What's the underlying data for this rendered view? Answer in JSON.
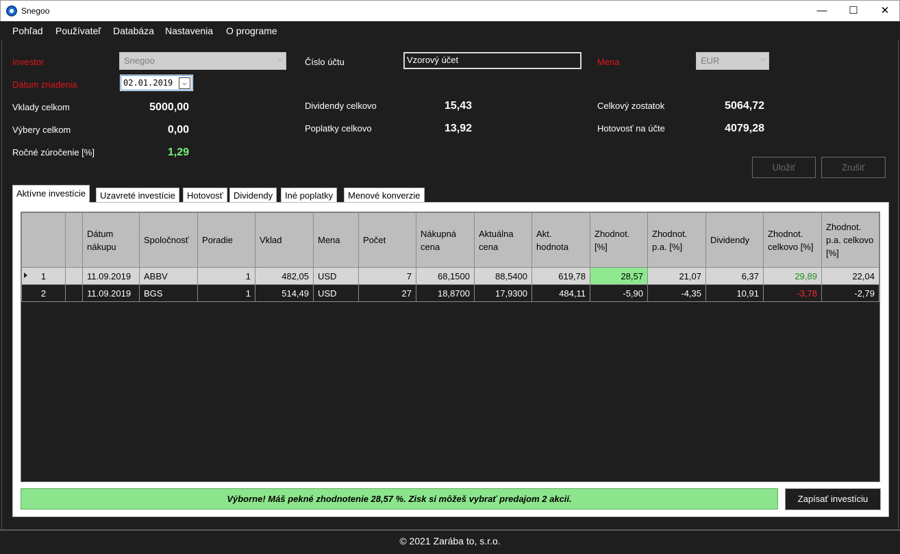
{
  "window": {
    "title": "Snegoo",
    "minimize": "—",
    "maximize": "☐",
    "close": "✕"
  },
  "menu": [
    "Pohľad",
    "Používateľ",
    "Databáza",
    "Nastavenia",
    "O programe"
  ],
  "form": {
    "investor_label": "Investor",
    "investor_value": "Snegoo",
    "datum_label": "Dátum zriadenia",
    "datum_value": "02.01.2019",
    "cislo_uctu_label": "Číslo účtu",
    "cislo_uctu_value": "Vzorový účet",
    "mena_label": "Mena",
    "mena_value": "EUR",
    "vklady_label": "Vklady celkom",
    "vklady_value": "5000,00",
    "vybery_label": "Výbery celkom",
    "vybery_value": "0,00",
    "rocne_label": "Ročné zúročenie [%]",
    "rocne_value": "1,29",
    "dividendy_label": "Dividendy celkovo",
    "dividendy_value": "15,43",
    "poplatky_label": "Poplatky celkovo",
    "poplatky_value": "13,92",
    "zostatok_label": "Celkový zostatok",
    "zostatok_value": "5064,72",
    "hotovost_label": "Hotovosť na účte",
    "hotovost_value": "4079,28",
    "ulozit": "Uložiť",
    "zrusit": "Zrušiť"
  },
  "tabs": [
    "Aktívne investície",
    "Uzavreté investície",
    "Hotovosť",
    "Dividendy",
    "Iné poplatky",
    "Menové konverzie"
  ],
  "grid": {
    "headers": [
      "",
      "",
      "Dátum nákupu",
      "Spoločnosť",
      "Poradie",
      "Vklad",
      "Mena",
      "Počet",
      "Nákupná cena",
      "Aktuálna cena",
      "Akt. hodnota",
      "Zhodnot. [%]",
      "Zhodnot. p.a. [%]",
      "Dividendy",
      "Zhodnot. celkovo [%]",
      "Zhodnot. p.a. celkovo [%]"
    ],
    "rows": [
      [
        "1",
        "",
        "11.09.2019",
        "ABBV",
        "1",
        "482,05",
        "USD",
        "7",
        "68,1500",
        "88,5400",
        "619,78",
        "28,57",
        "21,07",
        "6,37",
        "29,89",
        "22,04"
      ],
      [
        "2",
        "",
        "11.09.2019",
        "BGS",
        "1",
        "514,49",
        "USD",
        "27",
        "18,8700",
        "17,9300",
        "484,11",
        "-5,90",
        "-4,35",
        "10,91",
        "-3,78",
        "-2,79"
      ]
    ]
  },
  "message": "Výborne! Máš pekné zhodnotenie 28,57 %. Zisk si môžeš vybrať predajom 2 akcií.",
  "zapisat": "Zapísať investíciu",
  "footer": "© 2021 Zarába to, s.r.o.",
  "colors": {
    "label_required": "#e4141b",
    "positive": "#7cf07c",
    "highlight": "#8fe88f",
    "negative": "#ff2a2a"
  }
}
